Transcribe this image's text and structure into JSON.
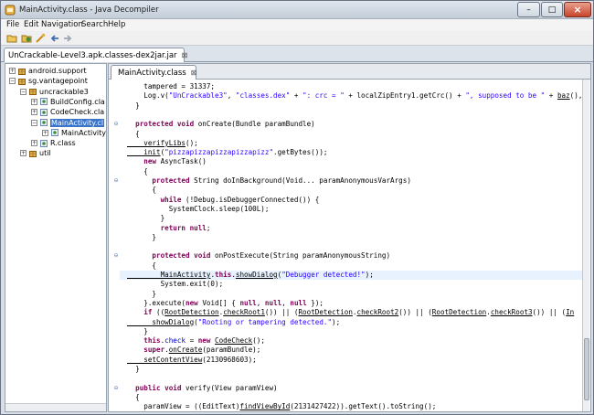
{
  "window": {
    "title": "MainActivity.class - Java Decompiler",
    "controls": {
      "minimize": "–",
      "maximize": "□",
      "close": "×"
    }
  },
  "menu": [
    "File",
    "Edit",
    "Navigation",
    "Search",
    "Help"
  ],
  "toolbar": {
    "icons": [
      "open-file-icon",
      "open-type-icon",
      "open-type-hierarchy-icon",
      "back-icon",
      "forward-icon"
    ]
  },
  "outer_tab": {
    "label": "UnCrackable-Level3.apk.classes-dex2jar.jar",
    "close": "⊠"
  },
  "tree": [
    {
      "label": "android.support",
      "level": 0,
      "expander": "+"
    },
    {
      "label": "sg.vantagepoint",
      "level": 0,
      "expander": "−"
    },
    {
      "label": "uncrackable3",
      "level": 1,
      "expander": "−"
    },
    {
      "label": "BuildConfig.cla",
      "level": 2,
      "expander": "+"
    },
    {
      "label": "CodeCheck.cla",
      "level": 2,
      "expander": "+"
    },
    {
      "label": "MainActivity.cl",
      "level": 2,
      "expander": "−",
      "selected": true
    },
    {
      "label": "MainActivity",
      "level": 3,
      "expander": "+"
    },
    {
      "label": "R.class",
      "level": 2,
      "expander": "+"
    },
    {
      "label": "util",
      "level": 1,
      "expander": "+"
    }
  ],
  "editor_tab": {
    "label": "MainActivity.class",
    "close": "⊠"
  },
  "code": [
    {
      "segs": [
        [
          "",
          "    tampered = 31337;"
        ]
      ]
    },
    {
      "segs": [
        [
          "",
          "    Log.v("
        ],
        [
          "str",
          "\"UnCrackable3\""
        ],
        [
          "",
          ", "
        ],
        [
          "str",
          "\"classes.dex\""
        ],
        [
          "",
          " + "
        ],
        [
          "str",
          "\": crc = \""
        ],
        [
          "",
          " + localZipEntry1.getCrc() + "
        ],
        [
          "str",
          "\", supposed to be \""
        ],
        [
          "",
          " + "
        ],
        [
          "ul",
          "baz"
        ],
        [
          "",
          "(),"
        ]
      ]
    },
    {
      "segs": [
        [
          "",
          "  }"
        ]
      ]
    },
    {
      "segs": [
        [
          "",
          ""
        ]
      ]
    },
    {
      "fold": "⊖",
      "segs": [
        [
          "kw",
          "  protected void "
        ],
        [
          "",
          "onCreate(Bundle paramBundle)"
        ]
      ]
    },
    {
      "segs": [
        [
          "",
          "  {"
        ]
      ]
    },
    {
      "segs": [
        [
          "ul",
          "    verifyLibs"
        ],
        [
          "",
          "();"
        ]
      ]
    },
    {
      "segs": [
        [
          "ul",
          "    init"
        ],
        [
          "",
          "("
        ],
        [
          "str",
          "\"pizzapizzapizzapizzapizz\""
        ],
        [
          "",
          ".getBytes());"
        ]
      ]
    },
    {
      "segs": [
        [
          "kw",
          "    new "
        ],
        [
          "",
          "AsyncTask()"
        ]
      ]
    },
    {
      "segs": [
        [
          "",
          "    {"
        ]
      ]
    },
    {
      "fold": "⊖",
      "segs": [
        [
          "kw",
          "      protected "
        ],
        [
          "",
          "String doInBackground(Void... paramAnonymousVarArgs)"
        ]
      ]
    },
    {
      "segs": [
        [
          "",
          "      {"
        ]
      ]
    },
    {
      "segs": [
        [
          "kw",
          "        while "
        ],
        [
          "",
          "(!Debug.isDebuggerConnected()) {"
        ]
      ]
    },
    {
      "segs": [
        [
          "",
          "          SystemClock.sleep(100L);"
        ]
      ]
    },
    {
      "segs": [
        [
          "",
          "        }"
        ]
      ]
    },
    {
      "segs": [
        [
          "kw",
          "        return null"
        ],
        [
          "",
          ";"
        ]
      ]
    },
    {
      "segs": [
        [
          "",
          "      }"
        ]
      ]
    },
    {
      "segs": [
        [
          "",
          ""
        ]
      ]
    },
    {
      "fold": "⊖",
      "segs": [
        [
          "kw",
          "      protected void "
        ],
        [
          "",
          "onPostExecute(String paramAnonymousString)"
        ]
      ]
    },
    {
      "segs": [
        [
          "",
          "      {"
        ]
      ]
    },
    {
      "hl": true,
      "segs": [
        [
          "ul",
          "        MainActivity"
        ],
        [
          "",
          "."
        ],
        [
          "kw",
          "this"
        ],
        [
          "",
          "."
        ],
        [
          "ul",
          "showDialog"
        ],
        [
          "",
          "("
        ],
        [
          "str",
          "\"Debugger detected!\""
        ],
        [
          "",
          ");"
        ]
      ]
    },
    {
      "segs": [
        [
          "",
          "        System.exit(0);"
        ]
      ]
    },
    {
      "segs": [
        [
          "",
          "      }"
        ]
      ]
    },
    {
      "segs": [
        [
          "",
          "    }.execute("
        ],
        [
          "kw",
          "new "
        ],
        [
          "",
          "Void[] { "
        ],
        [
          "kw",
          "null"
        ],
        [
          "",
          ", "
        ],
        [
          "kw",
          "null"
        ],
        [
          "",
          ", "
        ],
        [
          "kw",
          "null"
        ],
        [
          "",
          " });"
        ]
      ]
    },
    {
      "segs": [
        [
          "kw",
          "    if "
        ],
        [
          "",
          "(("
        ],
        [
          "ul",
          "RootDetection"
        ],
        [
          "",
          "."
        ],
        [
          "ul",
          "checkRoot1"
        ],
        [
          "",
          "()) || ("
        ],
        [
          "ul",
          "RootDetection"
        ],
        [
          "",
          "."
        ],
        [
          "ul",
          "checkRoot2"
        ],
        [
          "",
          "()) || ("
        ],
        [
          "ul",
          "RootDetection"
        ],
        [
          "",
          "."
        ],
        [
          "ul",
          "checkRoot3"
        ],
        [
          "",
          "()) || ("
        ],
        [
          "ul",
          "In"
        ]
      ]
    },
    {
      "segs": [
        [
          "ul",
          "      showDialog"
        ],
        [
          "",
          "("
        ],
        [
          "str",
          "\"Rooting or tampering detected.\""
        ],
        [
          "",
          ");"
        ]
      ]
    },
    {
      "segs": [
        [
          "",
          "    }"
        ]
      ]
    },
    {
      "segs": [
        [
          "kw",
          "    this"
        ],
        [
          "",
          "."
        ],
        [
          "mem",
          "check"
        ],
        [
          "",
          " = "
        ],
        [
          "kw",
          "new "
        ],
        [
          "ul",
          "CodeCheck"
        ],
        [
          "",
          "();"
        ]
      ]
    },
    {
      "segs": [
        [
          "kw",
          "    super"
        ],
        [
          "",
          "."
        ],
        [
          "ul",
          "onCreate"
        ],
        [
          "",
          "(paramBundle);"
        ]
      ]
    },
    {
      "segs": [
        [
          "ul",
          "    setContentView"
        ],
        [
          "",
          "(2130968603);"
        ]
      ]
    },
    {
      "segs": [
        [
          "",
          "  }"
        ]
      ]
    },
    {
      "segs": [
        [
          "",
          ""
        ]
      ]
    },
    {
      "fold": "⊖",
      "segs": [
        [
          "kw",
          "  public void "
        ],
        [
          "",
          "verify(View paramView)"
        ]
      ]
    },
    {
      "segs": [
        [
          "",
          "  {"
        ]
      ]
    },
    {
      "segs": [
        [
          "",
          "    paramView = ((EditText)"
        ],
        [
          "ul",
          "findViewById"
        ],
        [
          "",
          "(2131427422)).getText().toString();"
        ]
      ]
    }
  ],
  "colors": {
    "keyword": "#7f0055",
    "string": "#2a00ff",
    "selection": "#3a74c8",
    "highlight_line": "#e8f2fe"
  }
}
